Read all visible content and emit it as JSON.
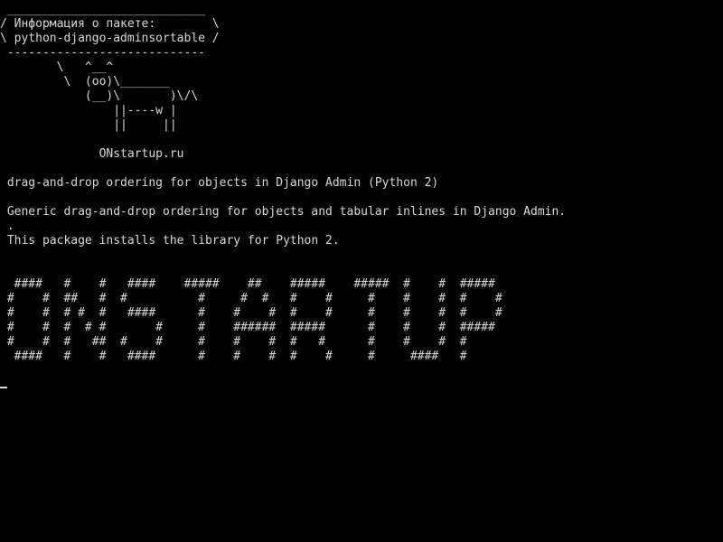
{
  "terminal": {
    "lines": [
      " ____________________________",
      "/ Информация о пакете:        \\",
      "\\ python-django-adminsortable /",
      " ----------------------------",
      "        \\   ^__^",
      "         \\  (oo)\\_______",
      "            (__)\\       )\\/\\",
      "                ||----w |",
      "                ||     ||",
      "",
      "              ONstartup.ru",
      "",
      " drag-and-drop ordering for objects in Django Admin (Python 2)",
      "",
      " Generic drag-and-drop ordering for objects and tabular inlines in Django Admin.",
      " .",
      " This package installs the library for Python 2.",
      "",
      "",
      "  ####   #    #   ####    #####    ##    #####    #####  #    #  #####",
      " #    #  ##   #  #          #     #  #   #    #     #    #    #  #    #",
      " #    #  # #  #   ####      #    #    #  #    #     #    #    #  #    #",
      " #    #  #  # #       #     #    ######  #####      #    #    #  #####",
      " #    #  #   ##  #    #     #    #    #  #   #      #    #    #  #",
      "  ####   #    #   ####      #    #    #  #    #     #     ####   #"
    ]
  }
}
